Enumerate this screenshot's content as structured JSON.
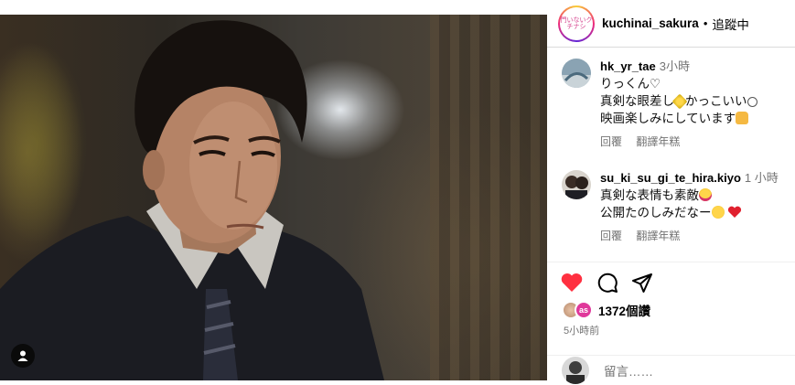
{
  "post": {
    "author": "kuchinai_sakura",
    "author_avatar_text": "門いないクチナシ",
    "separator": "•",
    "follow_status": "追蹤中"
  },
  "comments": [
    {
      "user": "hk_yr_tae",
      "time": "3小時",
      "lines": [
        "りっくん♡",
        "真剣な眼差し",
        "かっこいい",
        "映画楽しみにしています"
      ],
      "reply_label": "回覆",
      "translate_label": "翻譯年糕"
    },
    {
      "user": "su_ki_su_gi_te_hira.kiyo",
      "time": "1 小時",
      "lines": [
        "真剣な表情も素敵",
        "公開たのしみだなー"
      ],
      "reply_label": "回覆",
      "translate_label": "翻譯年糕"
    }
  ],
  "likes": {
    "liker_badge": "as",
    "count": "1372個讚"
  },
  "posted_time": "5小時前",
  "add_comment": {
    "placeholder": "留言……"
  },
  "colors": {
    "like_red": "#ff3040",
    "muted_text": "#737373",
    "divider": "#dbdbdb"
  },
  "icons": [
    "user-tag-icon",
    "heart-icon",
    "comment-icon",
    "share-icon",
    "sparkle-emoji-icon",
    "smile-emoji-icon",
    "hands-emoji-icon",
    "star-eyes-emoji-icon",
    "grin-emoji-icon",
    "red-heart-emoji-icon"
  ]
}
